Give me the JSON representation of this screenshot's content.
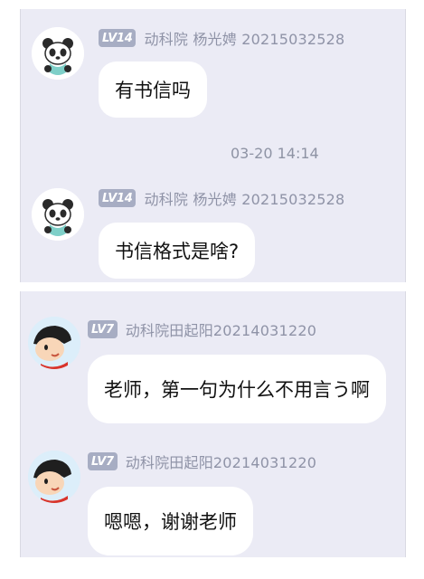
{
  "messages": [
    {
      "level": "LV14",
      "sender": "动科院  杨光娉  20215032528",
      "text": "有书信吗"
    },
    {
      "level": "LV14",
      "sender": "动科院  杨光娉  20215032528",
      "text": "书信格式是啥?"
    },
    {
      "level": "LV7",
      "sender": "动科院田起阳20214031220",
      "text": "老师，第一句为什么不用言う啊"
    },
    {
      "level": "LV7",
      "sender": "动科院田起阳20214031220",
      "text": "嗯嗯，谢谢老师"
    }
  ],
  "timestamp": "03-20 14:14",
  "colors": {
    "background": "#ebebf5",
    "bubble": "#ffffff",
    "level_badge": "#a7adc3",
    "meta_text": "#8f93a7"
  },
  "icons": [
    "panda-avatar",
    "cartoon-boy-avatar"
  ]
}
